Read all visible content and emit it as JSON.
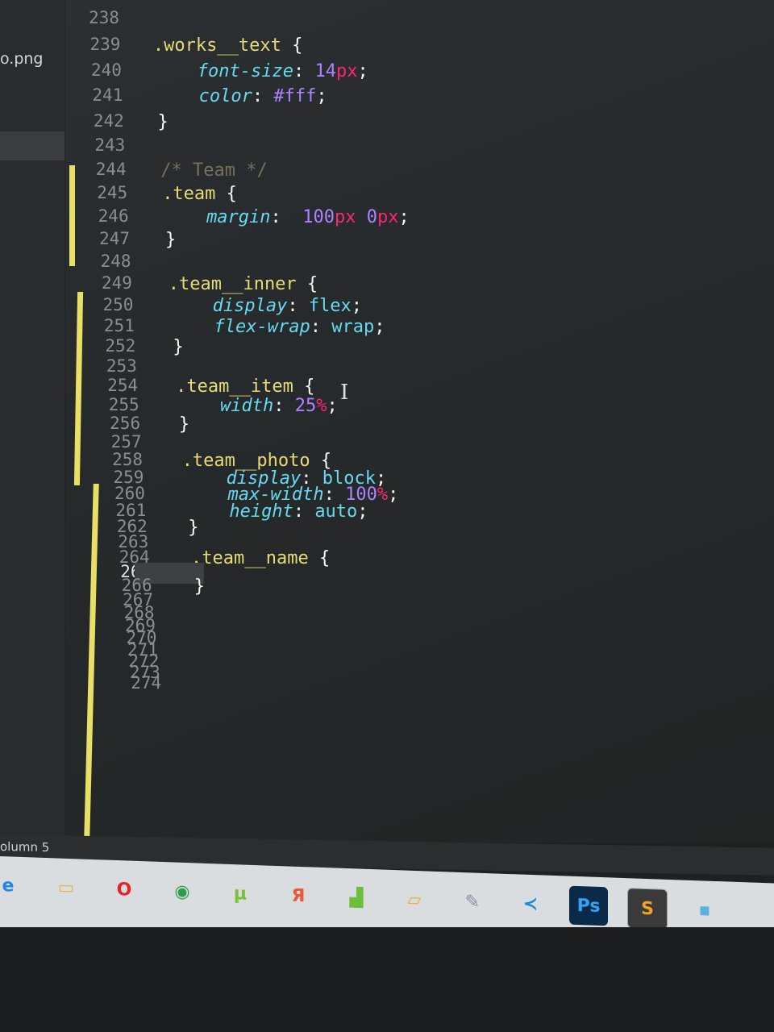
{
  "sidebar": {
    "file_label": "o.png"
  },
  "editor": {
    "lines": [
      {
        "n": "238",
        "tokens": []
      },
      {
        "n": "239",
        "tokens": [
          {
            "t": ".works__text",
            "c": "sel"
          },
          {
            "t": " {",
            "c": "punc"
          }
        ]
      },
      {
        "n": "240",
        "tokens": [
          {
            "t": "    ",
            "c": "punc"
          },
          {
            "t": "font-size",
            "c": "prop"
          },
          {
            "t": ": ",
            "c": "punc"
          },
          {
            "t": "14",
            "c": "num"
          },
          {
            "t": "px",
            "c": "unit"
          },
          {
            "t": ";",
            "c": "punc"
          }
        ]
      },
      {
        "n": "241",
        "tokens": [
          {
            "t": "    ",
            "c": "punc"
          },
          {
            "t": "color",
            "c": "prop"
          },
          {
            "t": ": ",
            "c": "punc"
          },
          {
            "t": "#fff",
            "c": "num"
          },
          {
            "t": ";",
            "c": "punc"
          }
        ]
      },
      {
        "n": "242",
        "tokens": [
          {
            "t": "}",
            "c": "punc"
          }
        ]
      },
      {
        "n": "243",
        "tokens": []
      },
      {
        "n": "244",
        "tokens": [
          {
            "t": "/* Team */",
            "c": "cmt"
          }
        ]
      },
      {
        "n": "245",
        "tokens": [
          {
            "t": ".team",
            "c": "sel"
          },
          {
            "t": " {",
            "c": "punc"
          }
        ]
      },
      {
        "n": "246",
        "tokens": [
          {
            "t": "    ",
            "c": "punc"
          },
          {
            "t": "margin",
            "c": "prop"
          },
          {
            "t": ":  ",
            "c": "punc"
          },
          {
            "t": "100",
            "c": "num"
          },
          {
            "t": "px",
            "c": "unit"
          },
          {
            "t": " ",
            "c": "punc"
          },
          {
            "t": "0",
            "c": "num"
          },
          {
            "t": "px",
            "c": "unit"
          },
          {
            "t": ";",
            "c": "punc"
          }
        ]
      },
      {
        "n": "247",
        "tokens": [
          {
            "t": "}",
            "c": "punc"
          }
        ]
      },
      {
        "n": "248",
        "tokens": []
      },
      {
        "n": "249",
        "tokens": [
          {
            "t": ".team__inner",
            "c": "sel"
          },
          {
            "t": " {",
            "c": "punc"
          }
        ]
      },
      {
        "n": "250",
        "tokens": [
          {
            "t": "    ",
            "c": "punc"
          },
          {
            "t": "display",
            "c": "prop"
          },
          {
            "t": ": ",
            "c": "punc"
          },
          {
            "t": "flex",
            "c": "val"
          },
          {
            "t": ";",
            "c": "punc"
          }
        ]
      },
      {
        "n": "251",
        "tokens": [
          {
            "t": "    ",
            "c": "punc"
          },
          {
            "t": "flex-wrap",
            "c": "prop"
          },
          {
            "t": ": ",
            "c": "punc"
          },
          {
            "t": "wrap",
            "c": "val"
          },
          {
            "t": ";",
            "c": "punc"
          }
        ]
      },
      {
        "n": "252",
        "tokens": [
          {
            "t": "}",
            "c": "punc"
          }
        ]
      },
      {
        "n": "253",
        "tokens": []
      },
      {
        "n": "254",
        "tokens": [
          {
            "t": ".team__item",
            "c": "sel"
          },
          {
            "t": " {",
            "c": "punc"
          }
        ]
      },
      {
        "n": "255",
        "tokens": [
          {
            "t": "    ",
            "c": "punc"
          },
          {
            "t": "width",
            "c": "prop"
          },
          {
            "t": ": ",
            "c": "punc"
          },
          {
            "t": "25",
            "c": "num"
          },
          {
            "t": "%",
            "c": "unit"
          },
          {
            "t": ";",
            "c": "punc"
          }
        ]
      },
      {
        "n": "256",
        "tokens": [
          {
            "t": "}",
            "c": "punc"
          }
        ]
      },
      {
        "n": "257",
        "tokens": []
      },
      {
        "n": "258",
        "tokens": [
          {
            "t": ".team__photo",
            "c": "sel"
          },
          {
            "t": " {",
            "c": "punc"
          }
        ]
      },
      {
        "n": "259",
        "tokens": [
          {
            "t": "    ",
            "c": "punc"
          },
          {
            "t": "display",
            "c": "prop"
          },
          {
            "t": ": ",
            "c": "punc"
          },
          {
            "t": "block",
            "c": "val"
          },
          {
            "t": ";",
            "c": "punc"
          }
        ]
      },
      {
        "n": "260",
        "tokens": [
          {
            "t": "    ",
            "c": "punc"
          },
          {
            "t": "max-width",
            "c": "prop"
          },
          {
            "t": ": ",
            "c": "punc"
          },
          {
            "t": "100",
            "c": "num"
          },
          {
            "t": "%",
            "c": "unit"
          },
          {
            "t": ";",
            "c": "punc"
          }
        ]
      },
      {
        "n": "261",
        "tokens": [
          {
            "t": "    ",
            "c": "punc"
          },
          {
            "t": "height",
            "c": "prop"
          },
          {
            "t": ": ",
            "c": "punc"
          },
          {
            "t": "auto",
            "c": "val"
          },
          {
            "t": ";",
            "c": "punc"
          }
        ]
      },
      {
        "n": "262",
        "tokens": [
          {
            "t": "}",
            "c": "punc"
          }
        ]
      },
      {
        "n": "263",
        "tokens": []
      },
      {
        "n": "264",
        "tokens": [
          {
            "t": ".team__name",
            "c": "sel"
          },
          {
            "t": " {",
            "c": "punc"
          }
        ]
      },
      {
        "n": "265",
        "tokens": [],
        "active": true
      },
      {
        "n": "266",
        "tokens": [
          {
            "t": "}",
            "c": "punc"
          }
        ]
      },
      {
        "n": "267",
        "tokens": []
      },
      {
        "n": "268",
        "tokens": []
      },
      {
        "n": "269",
        "tokens": []
      },
      {
        "n": "270",
        "tokens": []
      },
      {
        "n": "271",
        "tokens": []
      },
      {
        "n": "272",
        "tokens": []
      },
      {
        "n": "273",
        "tokens": []
      },
      {
        "n": "274",
        "tokens": []
      }
    ]
  },
  "statusbar": {
    "text": "olumn 5"
  },
  "taskbar": {
    "apps": [
      {
        "name": "ie-icon",
        "glyph": "e",
        "color": "#1e88e5",
        "bg": "transparent"
      },
      {
        "name": "file-explorer-icon",
        "glyph": "▭",
        "color": "#e0b84a",
        "bg": "transparent"
      },
      {
        "name": "opera-icon",
        "glyph": "O",
        "color": "#e0262b",
        "bg": "transparent"
      },
      {
        "name": "chrome-icon",
        "glyph": "◉",
        "color": "#2e9e48",
        "bg": "transparent"
      },
      {
        "name": "utorrent-icon",
        "glyph": "µ",
        "color": "#7bbf3a",
        "bg": "transparent"
      },
      {
        "name": "yandex-browser-icon",
        "glyph": "Я",
        "color": "#e85a3c",
        "bg": "transparent"
      },
      {
        "name": "chart-app-icon",
        "glyph": "▟",
        "color": "#6cbf3a",
        "bg": "transparent"
      },
      {
        "name": "notebook-app-icon",
        "glyph": "▱",
        "color": "#e0b43a",
        "bg": "transparent"
      },
      {
        "name": "paint-app-icon",
        "glyph": "✎",
        "color": "#8a8fa0",
        "bg": "transparent"
      },
      {
        "name": "vscode-icon",
        "glyph": "≺",
        "color": "#1e8ad6",
        "bg": "transparent"
      },
      {
        "name": "photoshop-icon",
        "glyph": "Ps",
        "color": "#2fa3f5",
        "bg": "#0b2a4a"
      },
      {
        "name": "sublime-text-icon",
        "glyph": "S",
        "color": "#f2a12a",
        "bg": "#3a3a3a",
        "active": true
      },
      {
        "name": "window-app-icon",
        "glyph": "▪",
        "color": "#5fb0e0",
        "bg": "transparent"
      }
    ]
  }
}
